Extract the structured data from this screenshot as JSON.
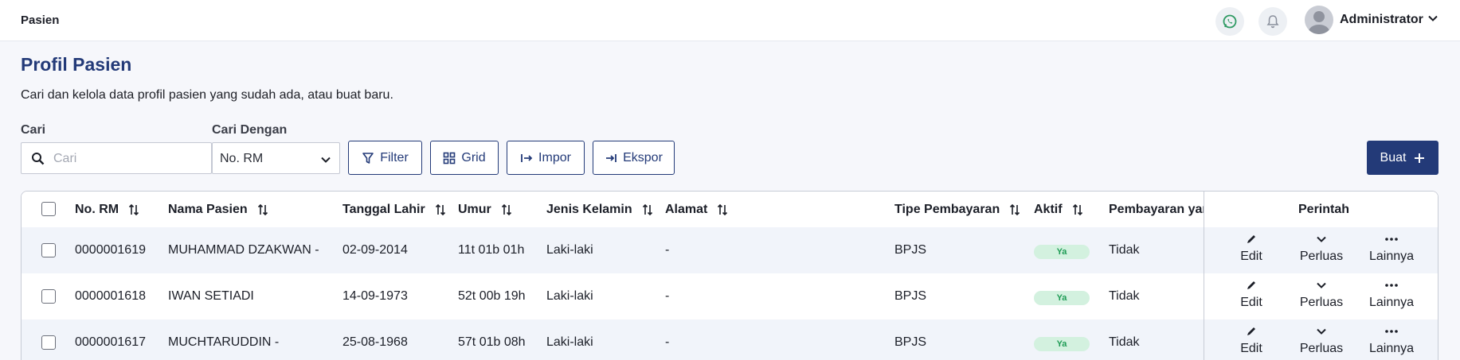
{
  "topbar": {
    "breadcrumb": "Pasien",
    "user_name": "Administrator",
    "whatsapp_icon": "whatsapp-icon",
    "bell_icon": "bell-icon"
  },
  "page": {
    "title": "Profil Pasien",
    "description": "Cari dan kelola data profil pasien yang sudah ada, atau buat baru."
  },
  "search": {
    "label": "Cari",
    "placeholder": "Cari",
    "by_label": "Cari Dengan",
    "by_value": "No. RM"
  },
  "toolbar": {
    "filter": "Filter",
    "grid": "Grid",
    "impor": "Impor",
    "ekspor": "Ekspor",
    "buat": "Buat"
  },
  "table": {
    "headers": {
      "no_rm": "No. RM",
      "nama": "Nama Pasien",
      "tgl": "Tanggal Lahir",
      "umur": "Umur",
      "jk": "Jenis Kelamin",
      "alamat": "Alamat",
      "tipe": "Tipe Pembayaran",
      "aktif": "Aktif",
      "pembayaran": "Pembayaran yan",
      "perintah": "Perintah"
    },
    "action_labels": {
      "edit": "Edit",
      "perluas": "Perluas",
      "lainnya": "Lainnya"
    },
    "rows": [
      {
        "no_rm": "0000001619",
        "nama": "MUHAMMAD DZAKWAN -",
        "tgl": "02-09-2014",
        "umur": "11t 01b 01h",
        "jk": "Laki-laki",
        "alamat": "-",
        "tipe": "BPJS",
        "aktif": "Ya",
        "pembayaran": "Tidak"
      },
      {
        "no_rm": "0000001618",
        "nama": "IWAN SETIADI",
        "tgl": "14-09-1973",
        "umur": "52t 00b 19h",
        "jk": "Laki-laki",
        "alamat": "-",
        "tipe": "BPJS",
        "aktif": "Ya",
        "pembayaran": "Tidak"
      },
      {
        "no_rm": "0000001617",
        "nama": "MUCHTARUDDIN -",
        "tgl": "25-08-1968",
        "umur": "57t 01b 08h",
        "jk": "Laki-laki",
        "alamat": "-",
        "tipe": "BPJS",
        "aktif": "Ya",
        "pembayaran": "Tidak"
      }
    ]
  },
  "colors": {
    "primary": "#233a78",
    "badge_bg": "#d3f1df",
    "badge_text": "#1f9c55",
    "row_alt": "#f1f4fa"
  }
}
